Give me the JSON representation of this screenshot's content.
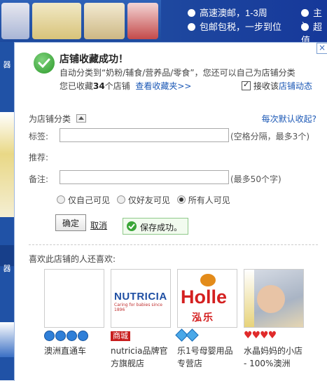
{
  "background": {
    "features": [
      {
        "label": "高速澳邮，1-3周",
        "icon": "dot-icon"
      },
      {
        "label": "包邮包税，一步到位",
        "icon": "dot-icon"
      },
      {
        "label": "主讠",
        "icon": "dot-icon"
      },
      {
        "label": "超值",
        "icon": "dot-icon"
      }
    ],
    "side_labels": [
      "器",
      "器"
    ],
    "colors": {
      "banner": "#2052a6"
    }
  },
  "dialog": {
    "close_label": "×",
    "title": "店铺收藏成功！",
    "subtext": "自动分类到“奶粉/辅食/营养品/零食”，您还可以自己为店铺分类",
    "collect_prefix": "您已收藏",
    "collect_count": "34",
    "collect_suffix": "个店铺",
    "view_favorites_link": "查看收藏夹>>",
    "receive_label": "接收该",
    "receive_link": "店铺动态",
    "category_label": "为店铺分类",
    "default_collapse_link": "每次默认收起?",
    "tags_label": "标签:",
    "tags_value": "",
    "tags_hint": "(空格分隔，最多3个)",
    "recommend_label": "推荐:",
    "note_label": "备注:",
    "note_value": "",
    "note_hint": "(最多50个字)",
    "visibility_options": [
      "仅自己可见",
      "仅好友可见",
      "所有人可见"
    ],
    "visibility_selected": "所有人可见",
    "confirm_button": "确定",
    "cancel_link": "取消",
    "saved_message": "保存成功。",
    "also_like_title": "喜欢此店铺的人还喜欢:",
    "shops": [
      {
        "name": "澳洲直通车",
        "badge": "crown",
        "badge_count": 4,
        "logo": ""
      },
      {
        "name": "nutricia品牌官方旗舰店",
        "badge": "mall",
        "badge_label": "商城",
        "logo": "NUTRICIA",
        "logo_sub": "Caring for babies since 1896"
      },
      {
        "name": "乐1号母婴用品专营店",
        "badge": "gem",
        "badge_count": 2,
        "logo": "Holle",
        "logo_sub": "泓乐"
      },
      {
        "name": "水晶妈妈的小店 - 100%澳洲",
        "badge": "heart",
        "badge_count": 4,
        "logo": ""
      }
    ],
    "colors": {
      "link": "#1a57b5",
      "success": "#3aa637",
      "mall": "#c81d1d"
    }
  }
}
